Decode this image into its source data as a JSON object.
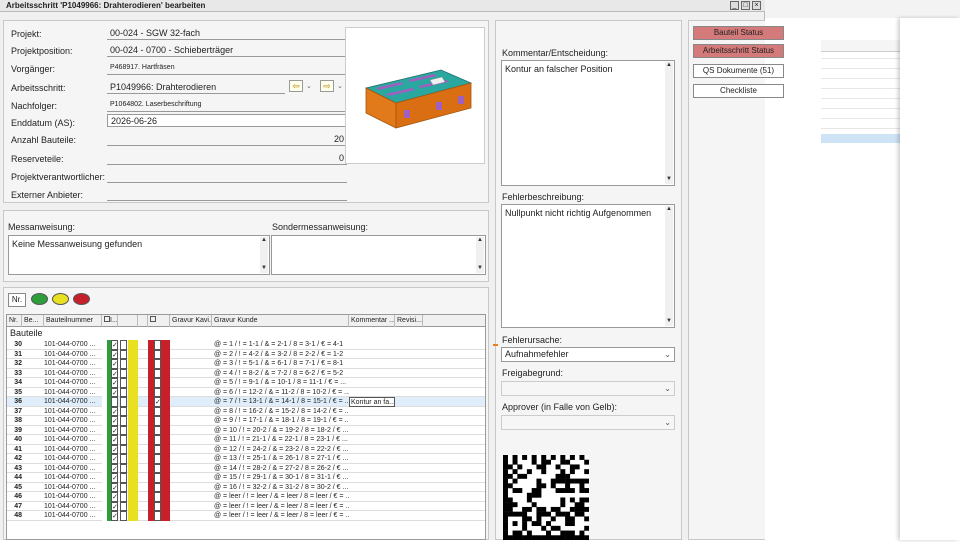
{
  "window": {
    "title": "Arbeitsschritt 'P1049966: Drahterodieren' bearbeiten"
  },
  "fields": {
    "projekt_label": "Projekt:",
    "projekt": "00-024 - SGW 32-fach",
    "projektposition_label": "Projektposition:",
    "projektposition": "00-024 - 0700 - Schieberträger",
    "vorgaenger_label": "Vorgänger:",
    "vorgaenger": "P468917. Hartfräsen",
    "arbeitsschritt_label": "Arbeitsschritt:",
    "arbeitsschritt": "P1049966: Drahterodieren",
    "nachfolger_label": "Nachfolger:",
    "nachfolger": "P1064802. Laserbeschriftung",
    "enddatum_label": "Enddatum (AS):",
    "enddatum": "2026-06-26",
    "anzahl_label": "Anzahl Bauteile:",
    "anzahl": "20",
    "reserve_label": "Reserveteile:",
    "reserve": "0",
    "verantwortlicher_label": "Projektverantwortlicher:",
    "verantwortlicher": "",
    "anbieter_label": "Externer Anbieter:",
    "anbieter": ""
  },
  "messanweisung": {
    "label": "Messanweisung:",
    "value": "Keine Messanweisung gefunden"
  },
  "sondermessanweisung": {
    "label": "Sondermessanweisung:",
    "value": ""
  },
  "legend": {
    "nr_label": "Nr.",
    "colors": [
      "#2e9e3a",
      "#e8e020",
      "#c8202a"
    ]
  },
  "grid": {
    "headers": [
      "Nr.",
      "Be...",
      "Bauteilnummer",
      "I...",
      "",
      "",
      "",
      "Gravur Kavi...",
      "Gravur Kunde",
      "Kommentar ...",
      "Revisi..."
    ],
    "group": "Bauteile",
    "rows": [
      {
        "nr": "30",
        "part": "101-044-0700 ...",
        "g": true,
        "y": false,
        "r": false,
        "kunde": "@ = 1 / ! = 1-1 / & = 2-1 / 8 = 3-1 / € = 4-1",
        "komm": ""
      },
      {
        "nr": "31",
        "part": "101-044-0700 ...",
        "g": true,
        "y": false,
        "r": false,
        "kunde": "@ = 2 / ! = 4-2 / & = 3-2 / 8 = 2-2 / € = 1-2",
        "komm": ""
      },
      {
        "nr": "32",
        "part": "101-044-0700 ...",
        "g": true,
        "y": false,
        "r": false,
        "kunde": "@ = 3 / ! = 5-1 / & = 6-1 / 8 = 7-1 / € = 8-1",
        "komm": ""
      },
      {
        "nr": "33",
        "part": "101-044-0700 ...",
        "g": true,
        "y": false,
        "r": false,
        "kunde": "@ = 4 / ! = 8-2 / & = 7-2 / 8 = 6-2 / € = 5-2",
        "komm": ""
      },
      {
        "nr": "34",
        "part": "101-044-0700 ...",
        "g": true,
        "y": false,
        "r": false,
        "kunde": "@ = 5 / ! = 9-1 / & = 10-1 / 8 = 11-1 / € = ...",
        "komm": ""
      },
      {
        "nr": "35",
        "part": "101-044-0700 ...",
        "g": true,
        "y": false,
        "r": false,
        "kunde": "@ = 6 / ! = 12-2 / & = 11-2 / 8 = 10-2 / € = ...",
        "komm": ""
      },
      {
        "nr": "36",
        "part": "101-044-0700 ...",
        "g": false,
        "y": false,
        "r": true,
        "kunde": "@ = 7 / ! = 13-1 / & = 14-1 / 8 = 15-1 / € = ...",
        "komm": "Kontur an fa...",
        "sel": true
      },
      {
        "nr": "37",
        "part": "101-044-0700 ...",
        "g": true,
        "y": false,
        "r": false,
        "kunde": "@ = 8 / ! = 16-2 / & = 15-2 / 8 = 14-2 / € = ...",
        "komm": ""
      },
      {
        "nr": "38",
        "part": "101-044-0700 ...",
        "g": true,
        "y": false,
        "r": false,
        "kunde": "@ = 9 / ! = 17-1 / & = 18-1 / 8 = 19-1 / € = ...",
        "komm": ""
      },
      {
        "nr": "39",
        "part": "101-044-0700 ...",
        "g": true,
        "y": false,
        "r": false,
        "kunde": "@ = 10 / ! = 20-2 / & = 19-2 / 8 = 18-2 / € ...",
        "komm": ""
      },
      {
        "nr": "40",
        "part": "101-044-0700 ...",
        "g": true,
        "y": false,
        "r": false,
        "kunde": "@ = 11 / ! = 21-1 / & = 22-1 / 8 = 23-1 / € ...",
        "komm": ""
      },
      {
        "nr": "41",
        "part": "101-044-0700 ...",
        "g": true,
        "y": false,
        "r": false,
        "kunde": "@ = 12 / ! = 24-2 / & = 23-2 / 8 = 22-2 / € ...",
        "komm": ""
      },
      {
        "nr": "42",
        "part": "101-044-0700 ...",
        "g": true,
        "y": false,
        "r": false,
        "kunde": "@ = 13 / ! = 25-1 / & = 26-1 / 8 = 27-1 / € ...",
        "komm": ""
      },
      {
        "nr": "43",
        "part": "101-044-0700 ...",
        "g": true,
        "y": false,
        "r": false,
        "kunde": "@ = 14 / ! = 28-2 / & = 27-2 / 8 = 26-2 / € ...",
        "komm": ""
      },
      {
        "nr": "44",
        "part": "101-044-0700 ...",
        "g": true,
        "y": false,
        "r": false,
        "kunde": "@ = 15 / ! = 29-1 / & = 30-1 / 8 = 31-1 / € ...",
        "komm": ""
      },
      {
        "nr": "45",
        "part": "101-044-0700 ...",
        "g": true,
        "y": false,
        "r": false,
        "kunde": "@ = 16 / ! = 32-2 / & = 31-2 / 8 = 30-2 / € ...",
        "komm": ""
      },
      {
        "nr": "46",
        "part": "101-044-0700 ...",
        "g": true,
        "y": false,
        "r": false,
        "kunde": "@ = leer / ! = leer / & = leer / 8 = leer / € = ...",
        "komm": ""
      },
      {
        "nr": "47",
        "part": "101-044-0700 ...",
        "g": true,
        "y": false,
        "r": false,
        "kunde": "@ = leer / ! = leer / & = leer / 8 = leer / € = ...",
        "komm": ""
      },
      {
        "nr": "48",
        "part": "101-044-0700 ...",
        "g": true,
        "y": false,
        "r": false,
        "kunde": "@ = leer / ! = leer / & = leer / 8 = leer / € = ...",
        "komm": ""
      }
    ]
  },
  "kommentar": {
    "label": "Kommentar/Entscheidung:",
    "value": "Kontur an falscher Position"
  },
  "fehlerbeschreibung": {
    "label": "Fehlerbeschreibung:",
    "value": "Nullpunkt nicht richtig Aufgenommen"
  },
  "fehlerursache": {
    "label": "Fehlerursache:",
    "value": "Aufnahmefehler"
  },
  "freigabegrund": {
    "label": "Freigabegrund:",
    "value": ""
  },
  "approver": {
    "label": "Approver (in Falle von Gelb):",
    "value": ""
  },
  "buttons": {
    "bauteil_status": "Bauteil Status",
    "arbeitsschritt_status": "Arbeitsschritt Status",
    "qs_dokumente": "QS Dokumente (51)",
    "checkliste": "Checkliste"
  },
  "colors": {
    "green": "#2e9e3a",
    "yellow": "#e8e020",
    "red": "#c8202a",
    "status_button": "#d47a7a"
  }
}
